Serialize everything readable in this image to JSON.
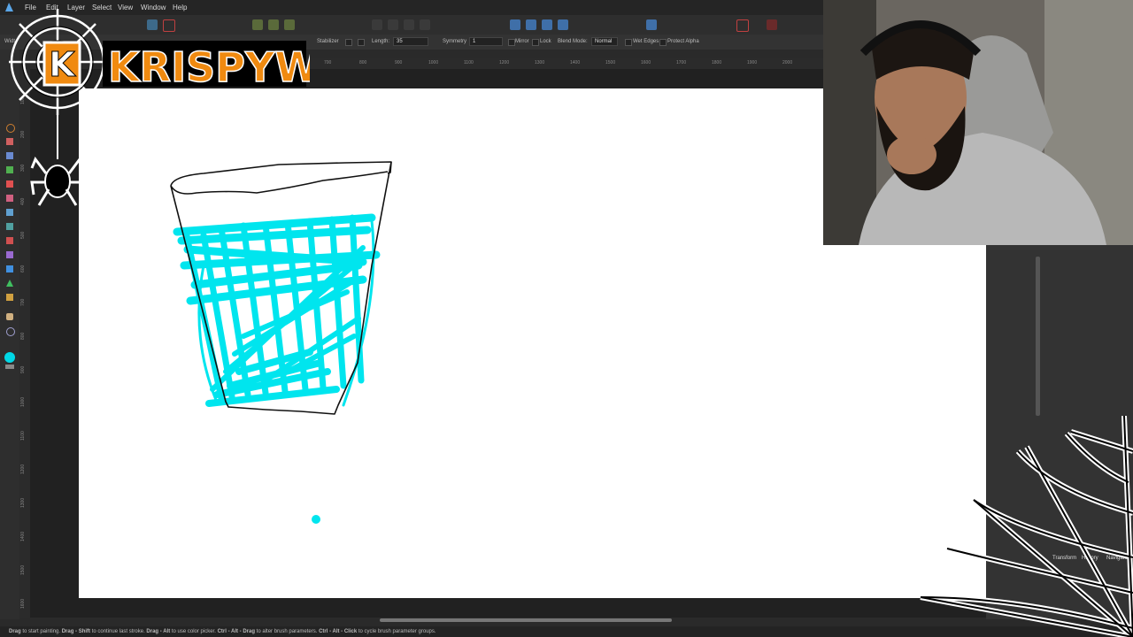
{
  "menu": {
    "items": [
      "File",
      "Edit",
      "Layer",
      "Select",
      "View",
      "Window",
      "Help"
    ]
  },
  "context_toolbar": {
    "partial_label": "Widt",
    "stabilizer_label": "Stabilizer",
    "length_label": "Length:",
    "length_value": "35",
    "symmetry_label": "Symmetry",
    "symmetry_value": "1",
    "mirror_label": "Mirror",
    "lock_label": "Lock",
    "blend_mode_label": "Blend Mode:",
    "blend_mode_value": "Normal",
    "wet_edges_label": "Wet Edges",
    "protect_alpha_label": "Protect Alpha"
  },
  "ruler": {
    "horizontal": [
      "700",
      "800",
      "900",
      "1000",
      "1100",
      "1200",
      "1300",
      "1400",
      "1500",
      "1600",
      "1700",
      "1800",
      "1900",
      "2000"
    ],
    "vertical": [
      "100",
      "200",
      "300",
      "400",
      "500",
      "600",
      "700",
      "800",
      "900",
      "1000",
      "1100",
      "1200",
      "1300",
      "1400",
      "1500",
      "1600"
    ]
  },
  "panel": {
    "tabs": [
      "Transform",
      "History",
      "Navigator"
    ]
  },
  "status": {
    "segments": [
      {
        "text": "Drag",
        "bold": true
      },
      {
        "text": " to start painting. ",
        "bold": false
      },
      {
        "text": "Drag - Shift",
        "bold": true
      },
      {
        "text": " to continue last stroke. ",
        "bold": false
      },
      {
        "text": "Drag - Alt",
        "bold": true
      },
      {
        "text": " to use color picker. ",
        "bold": false
      },
      {
        "text": "Ctrl - Alt - Drag",
        "bold": true
      },
      {
        "text": " to alter brush parameters. ",
        "bold": false
      },
      {
        "text": "Ctrl - Alt - Click",
        "bold": true
      },
      {
        "text": " to cycle brush parameter groups.",
        "bold": false
      }
    ]
  },
  "overlay": {
    "logo_text": "KRISPYW",
    "logo_letter": "K"
  },
  "colors": {
    "brush": "#00e5ee",
    "logo_orange": "#f08a10",
    "canvas": "#ffffff",
    "ui_dark": "#2e2e2e"
  }
}
